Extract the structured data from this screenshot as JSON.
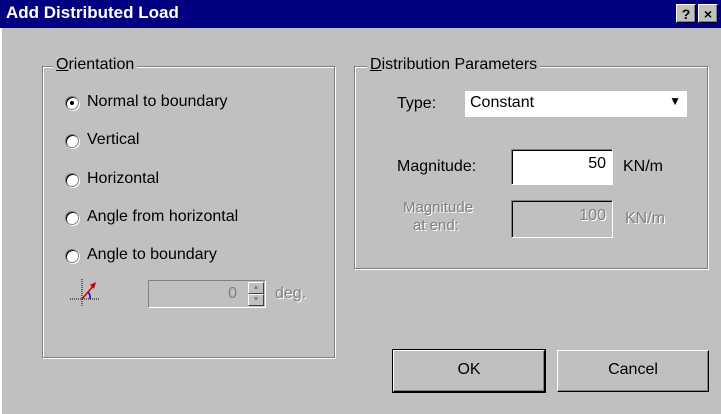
{
  "window": {
    "title": "Add Distributed Load",
    "help_button": "?",
    "close_button": "×"
  },
  "orientation": {
    "legend_underlined": "O",
    "legend_rest": "rientation",
    "options": [
      {
        "label": "Normal to boundary",
        "selected": true
      },
      {
        "label": "Vertical",
        "selected": false
      },
      {
        "label": "Horizontal",
        "selected": false
      },
      {
        "label": "Angle from horizontal",
        "selected": false
      },
      {
        "label": "Angle to boundary",
        "selected": false
      }
    ],
    "angle_icon": "angle-axes-icon",
    "angle_value": "0",
    "angle_unit": "deg."
  },
  "distribution": {
    "legend_underlined": "D",
    "legend_rest": "istribution Parameters",
    "type_label": "Type:",
    "type_value": "Constant",
    "magnitude_label": "Magnitude:",
    "magnitude_value": "50",
    "magnitude_unit": "KN/m",
    "magnitude_end_label_line1": "Magnitude",
    "magnitude_end_label_line2": "at end:",
    "magnitude_end_value": "100",
    "magnitude_end_unit": "KN/m"
  },
  "buttons": {
    "ok": "OK",
    "cancel": "Cancel"
  },
  "colors": {
    "titlebar": "#000080",
    "face": "#c0c0c0",
    "disabled_text": "#808080",
    "arrow_red": "#cc0000",
    "arc_blue": "#0000cc"
  }
}
